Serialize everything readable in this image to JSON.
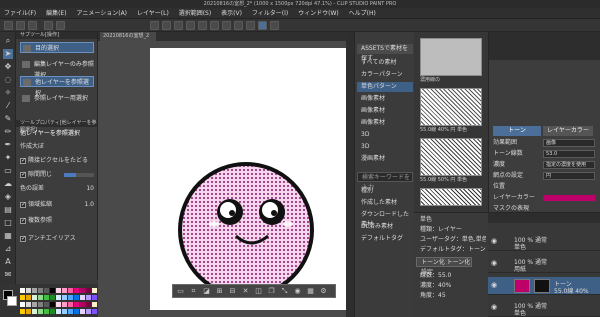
{
  "window": {
    "title": "20210816の室想_2* (1000 x 1500px 720dpi 47.1%) - CLIP STUDIO PAINT PRO"
  },
  "menu": [
    "ファイル(F)",
    "編集(E)",
    "アニメーション(A)",
    "レイヤー(L)",
    "選択範囲(S)",
    "表示(V)",
    "フィルター(I)",
    "ウィンドウ(W)",
    "ヘルプ(H)"
  ],
  "document_tab": "20210816の室想_2",
  "subtool": {
    "title": "サブツール[操作]",
    "items": [
      {
        "label": "目的選択",
        "selected": true
      },
      {
        "label": "編集レイヤーのみ参照選択",
        "selected": false
      },
      {
        "label": "他レイヤーを参照選択",
        "selected": true
      },
      {
        "label": "参照レイヤー用選択",
        "selected": false
      }
    ]
  },
  "toolprop": {
    "title": "ツールプロパティ[他レイヤーを参照選択]",
    "header": "他レイヤーを参照選択",
    "rows": [
      {
        "label": "作成大ぼ",
        "checkbox": false
      },
      {
        "label": "隣接ピクセルをたどる",
        "checkbox": true
      },
      {
        "label": "隙間閉じ",
        "checkbox": true
      },
      {
        "label": "色の誤差",
        "checkbox": false,
        "value": "10"
      },
      {
        "label": "領域拡縮",
        "checkbox": true,
        "value": "1.0"
      },
      {
        "label": "複数参照",
        "checkbox": true
      },
      {
        "label": "アンチエイリアス",
        "checkbox": true
      }
    ]
  },
  "materials": {
    "tree": [
      "ASSETSで素材を探す",
      "すべての素材",
      "カラーパターン",
      "単色パターン",
      "画像素材",
      "画像素材",
      "画像素材",
      "3D",
      "3D",
      "漫画素材"
    ],
    "search_placeholder": "検索キーワードを入力",
    "filters": [
      "種別",
      "作成した素材",
      "ダウンロードした素材",
      "DL済み素材",
      "デフォルトタグ"
    ],
    "thumb_labels": [
      "濃用線の",
      "55.0線 40% 円 単色",
      "55.0線 50% 円 単色",
      "55.0線 60% 円 単色"
    ]
  },
  "material_detail": {
    "lines": [
      "単色",
      "種類：レイヤー",
      "ユーザータグ：単色,単色パターン,濃い色",
      "デフォルトタグ：トーン 円 55線",
      "トーン化 トーン化設定",
      "線数：55.0",
      "濃度：40%",
      "角度：45"
    ]
  },
  "layer_property": {
    "tabs": [
      "トーン",
      "レイヤーカラー"
    ],
    "rows": [
      {
        "label": "効果範囲",
        "value": "画像"
      },
      {
        "label": "トーン線数",
        "value": "53.0"
      },
      {
        "label": "濃度",
        "value": "指定の濃度を使用"
      },
      {
        "label": "網点の設定",
        "value": "円"
      },
      {
        "label": "位置",
        "value": ""
      },
      {
        "label": "レイヤーカラー",
        "value": ""
      },
      {
        "label": "マスクの表現",
        "value": ""
      }
    ],
    "accent": "#c0006a"
  },
  "layers": [
    {
      "name": "100 % 通常",
      "sub": "単色"
    },
    {
      "name": "100 % 通常",
      "sub": "用紙"
    },
    {
      "name": "トーン",
      "sub": "55.0線 40%"
    },
    {
      "name": "100 % 通常",
      "sub": "単色"
    }
  ],
  "colors": {
    "canvas_face": "#f2c2e8",
    "dot": "#8a1b6d",
    "accent": "#3e5f86"
  }
}
